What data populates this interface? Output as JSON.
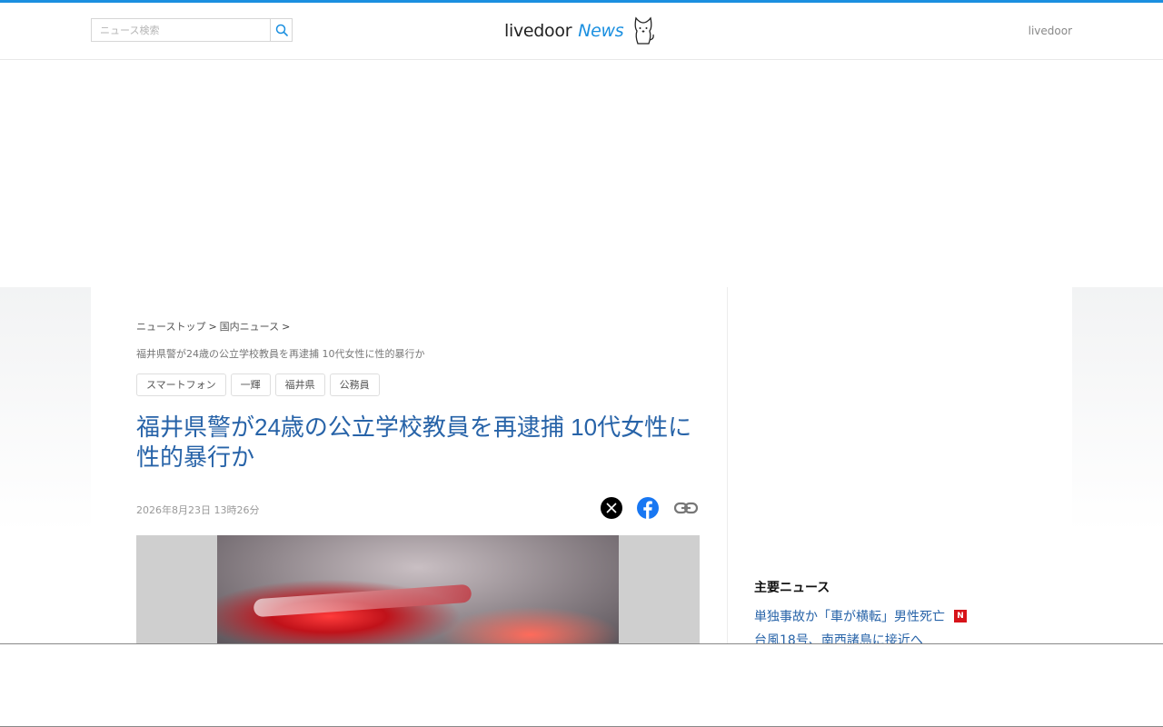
{
  "header": {
    "search_placeholder": "ニュース検索",
    "logo_text": "livedoor",
    "logo_news": "News",
    "right_link": "livedoor"
  },
  "breadcrumb": {
    "items": [
      "ニューストップ",
      "国内ニュース"
    ],
    "separator": ">",
    "current": "福井県警が24歳の公立学校教員を再逮捕 10代女性に性的暴行か"
  },
  "tags": [
    "スマートフォン",
    "一輝",
    "福井県",
    "公務員"
  ],
  "article": {
    "title": "福井県警が24歳の公立学校教員を再逮捕 10代女性に性的暴行か",
    "date": "2026年8月23日 13時26分"
  },
  "share": {
    "icons": [
      "x-icon",
      "facebook-icon",
      "link-icon"
    ]
  },
  "sidebar": {
    "title": "主要ニュース",
    "items": [
      {
        "label": "単独事故か「車が横転」男性死亡",
        "badge": "N"
      },
      {
        "label": "台風18号、南西諸島に接近へ",
        "badge": ""
      }
    ]
  },
  "colors": {
    "accent": "#1a8fe0",
    "title_blue": "#2763a8",
    "new_badge": "#d7141a"
  }
}
